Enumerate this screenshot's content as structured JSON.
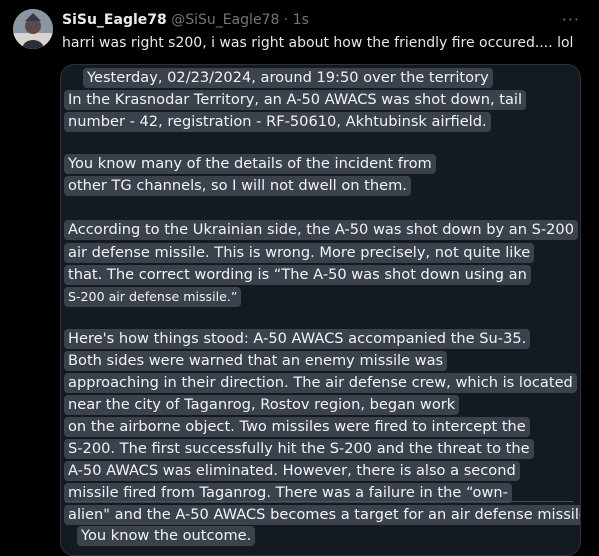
{
  "author": {
    "name": "SiSu_Eagle78",
    "handle": "@SiSu_Eagle78",
    "separator": "·",
    "time": "1s"
  },
  "more_label": "···",
  "text": "harri was right s200, i was right about how the friendly fire occured.... lol",
  "image_lines": [
    "Yesterday, 02/23/2024, around 19:50 over the territory",
    "In the Krasnodar Territory, an A-50 AWACS was shot down, tail",
    "number - 42, registration - RF-50610, Akhtubinsk airfield.",
    "You know many of the details of the incident from",
    "other TG channels, so I will not dwell on them.",
    "According to the Ukrainian side, the A-50 was shot down by an S-200",
    "air defense missile. This is wrong. More precisely, not quite like",
    "that. The correct wording is “The A-50 was shot down using an",
    "S-200 air defense missile.”",
    "Here's how things stood: A-50 AWACS accompanied the Su-35.",
    "Both sides were warned that an enemy missile was",
    "approaching in their direction. The air defense crew, which is located",
    "near the city of Taganrog, Rostov region, began work",
    "on the airborne object. Two missiles were fired to intercept the",
    "S-200. The first successfully hit the S-200 and the threat to the",
    "A-50 AWACS was eliminated. However, there is also a second",
    "missile fired from Taganrog. There was a failure in the “own-",
    "alien\" and the A-50 AWACS becomes a target for an air defense missile.",
    "You know the outcome."
  ]
}
